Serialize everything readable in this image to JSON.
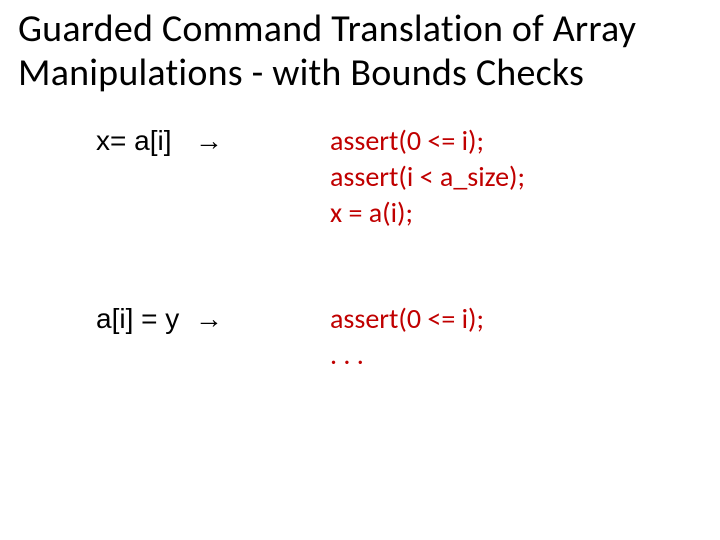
{
  "title": "Guarded Command Translation of Array Manipululations - with Bounds Checks",
  "title_fixed": "Guarded Command Translation of Array Manipulations - with Bounds Checks",
  "rows": [
    {
      "left": "x= a[i]   →",
      "right": "assert(0 <= i);\nassert(i < a_size);\nx = a(i);"
    },
    {
      "left": "a[i] = y  →",
      "right": "assert(0 <= i);\n. . ."
    }
  ]
}
